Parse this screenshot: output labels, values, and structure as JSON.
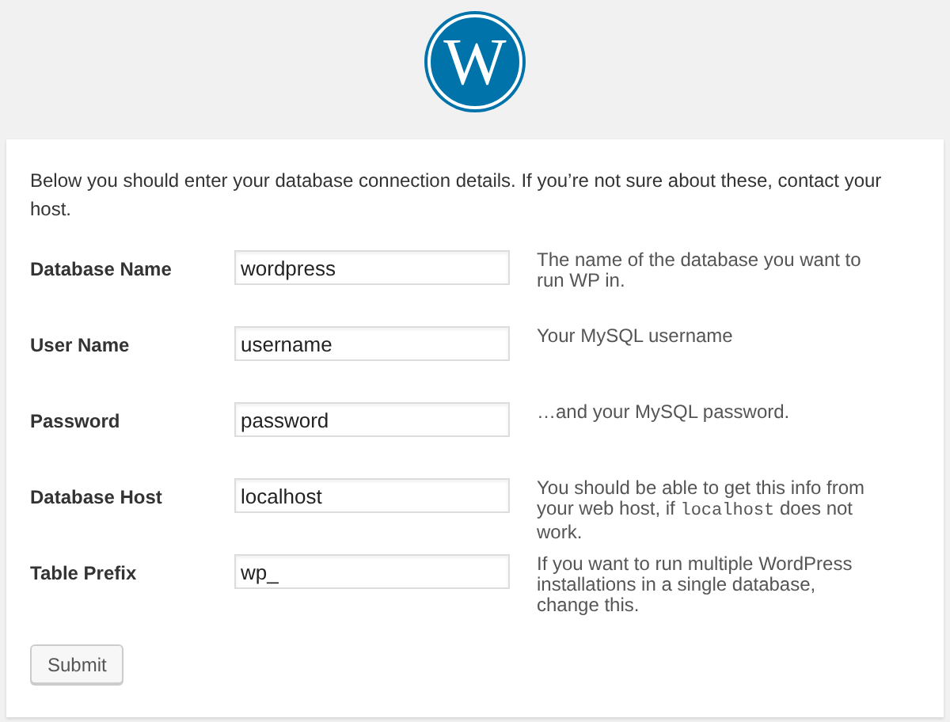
{
  "logo": {
    "mark": "W"
  },
  "intro": "Below you should enter your database connection details. If you’re not sure about these, contact your host.",
  "fields": [
    {
      "label": "Database Name",
      "value": "wordpress",
      "hint": [
        {
          "kind": "text",
          "text": "The name of the database you want to run WP in."
        }
      ]
    },
    {
      "label": "User Name",
      "value": "username",
      "hint": [
        {
          "kind": "text",
          "text": "Your MySQL username"
        }
      ]
    },
    {
      "label": "Password",
      "value": "password",
      "hint": [
        {
          "kind": "text",
          "text": "…and your MySQL password."
        }
      ]
    },
    {
      "label": "Database Host",
      "value": "localhost",
      "hint": [
        {
          "kind": "text",
          "text": "You should be able to get this info from your web host, if "
        },
        {
          "kind": "code",
          "text": "localhost"
        },
        {
          "kind": "text",
          "text": " does not work."
        }
      ]
    },
    {
      "label": "Table Prefix",
      "value": "wp_",
      "hint": [
        {
          "kind": "text",
          "text": "If you want to run multiple WordPress installations in a single database, change this."
        }
      ]
    }
  ],
  "submit": "Submit"
}
